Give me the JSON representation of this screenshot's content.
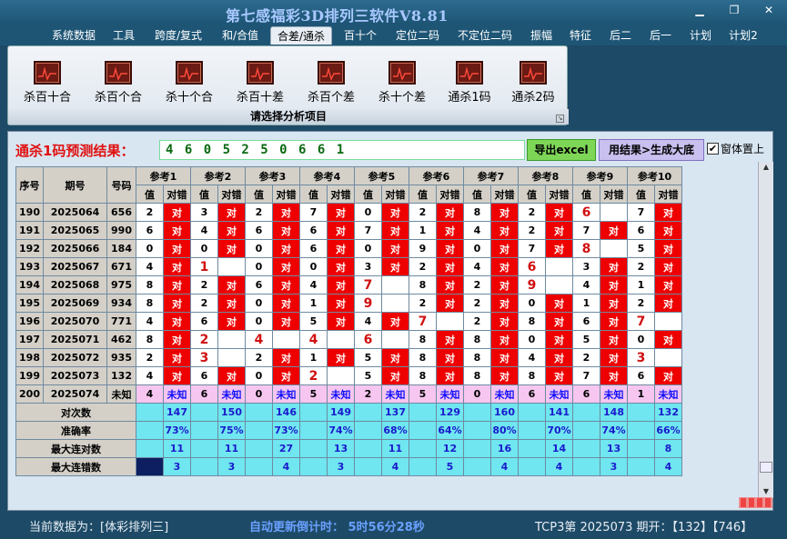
{
  "window": {
    "title": "第七感福彩3D排列三软件V8.81"
  },
  "menu": {
    "items": [
      "系统数据",
      "工具",
      "跨度/复式",
      "和/合值",
      "合差/通杀",
      "百十个",
      "定位二码",
      "不定位二码",
      "振幅",
      "特征",
      "后二",
      "后一",
      "计划",
      "计划2"
    ],
    "active": 4
  },
  "ribbon": {
    "buttons": [
      "杀百十合",
      "杀百个合",
      "杀十个合",
      "杀百十差",
      "杀百个差",
      "杀十个差",
      "通杀1码",
      "通杀2码"
    ],
    "caption": "请选择分析项目"
  },
  "prediction": {
    "label": "通杀1码预测结果：",
    "value": "4 6 0 5 2 5 0 6 6 1",
    "excel_btn": "导出excel",
    "gen_btn": "用结果>生成大底",
    "topmost_label": "窗体置上",
    "topmost_checked": true
  },
  "table": {
    "header": {
      "seq": "序号",
      "period": "期号",
      "number": "号码",
      "value_sub": "值",
      "hit_sub": "对错"
    },
    "refs": [
      "参考1",
      "参考2",
      "参考3",
      "参考4",
      "参考5",
      "参考6",
      "参考7",
      "参考8",
      "参考9",
      "参考10"
    ],
    "rows": [
      {
        "seq": "190",
        "period": "2025064",
        "num": "656",
        "vals": [
          "2",
          "3",
          "2",
          "7",
          "0",
          "2",
          "8",
          "2",
          "6",
          "7"
        ],
        "hits": [
          "对",
          "对",
          "对",
          "对",
          "对",
          "对",
          "对",
          "对",
          "",
          "对"
        ],
        "hot": [
          0,
          0,
          0,
          0,
          0,
          0,
          0,
          0,
          1,
          0
        ]
      },
      {
        "seq": "191",
        "period": "2025065",
        "num": "990",
        "vals": [
          "6",
          "4",
          "6",
          "6",
          "7",
          "1",
          "4",
          "2",
          "7",
          "6"
        ],
        "hits": [
          "对",
          "对",
          "对",
          "对",
          "对",
          "对",
          "对",
          "对",
          "对",
          "对"
        ],
        "hot": [
          0,
          0,
          0,
          0,
          0,
          0,
          0,
          0,
          0,
          0
        ]
      },
      {
        "seq": "192",
        "period": "2025066",
        "num": "184",
        "vals": [
          "0",
          "0",
          "0",
          "6",
          "0",
          "9",
          "0",
          "7",
          "8",
          "5"
        ],
        "hits": [
          "对",
          "对",
          "对",
          "对",
          "对",
          "对",
          "对",
          "对",
          "",
          "对"
        ],
        "hot": [
          0,
          0,
          0,
          0,
          0,
          0,
          0,
          0,
          1,
          0
        ]
      },
      {
        "seq": "193",
        "period": "2025067",
        "num": "671",
        "vals": [
          "4",
          "1",
          "0",
          "0",
          "3",
          "2",
          "4",
          "6",
          "3",
          "2"
        ],
        "hits": [
          "对",
          "",
          "对",
          "对",
          "对",
          "对",
          "对",
          "",
          "对",
          "对"
        ],
        "hot": [
          0,
          1,
          0,
          0,
          0,
          0,
          0,
          1,
          0,
          0
        ]
      },
      {
        "seq": "194",
        "period": "2025068",
        "num": "975",
        "vals": [
          "8",
          "2",
          "6",
          "4",
          "7",
          "8",
          "2",
          "9",
          "4",
          "1"
        ],
        "hits": [
          "对",
          "对",
          "对",
          "对",
          "",
          "对",
          "对",
          "",
          "对",
          "对"
        ],
        "hot": [
          0,
          0,
          0,
          0,
          1,
          0,
          0,
          1,
          0,
          0
        ]
      },
      {
        "seq": "195",
        "period": "2025069",
        "num": "934",
        "vals": [
          "8",
          "2",
          "0",
          "1",
          "9",
          "2",
          "2",
          "0",
          "1",
          "2"
        ],
        "hits": [
          "对",
          "对",
          "对",
          "对",
          "",
          "对",
          "对",
          "对",
          "对",
          "对"
        ],
        "hot": [
          0,
          0,
          0,
          0,
          1,
          0,
          0,
          0,
          0,
          0
        ]
      },
      {
        "seq": "196",
        "period": "2025070",
        "num": "771",
        "vals": [
          "4",
          "6",
          "0",
          "5",
          "4",
          "7",
          "2",
          "8",
          "6",
          "7"
        ],
        "hits": [
          "对",
          "对",
          "对",
          "对",
          "对",
          "",
          "对",
          "对",
          "对",
          ""
        ],
        "hot": [
          0,
          0,
          0,
          0,
          0,
          1,
          0,
          0,
          0,
          1
        ]
      },
      {
        "seq": "197",
        "period": "2025071",
        "num": "462",
        "vals": [
          "8",
          "2",
          "4",
          "4",
          "6",
          "8",
          "8",
          "0",
          "5",
          "0"
        ],
        "hits": [
          "对",
          "",
          "",
          "",
          "",
          "对",
          "对",
          "对",
          "对",
          "对"
        ],
        "hot": [
          0,
          1,
          1,
          1,
          1,
          0,
          0,
          0,
          0,
          0
        ]
      },
      {
        "seq": "198",
        "period": "2025072",
        "num": "935",
        "vals": [
          "2",
          "3",
          "2",
          "1",
          "5",
          "8",
          "8",
          "4",
          "2",
          "3"
        ],
        "hits": [
          "对",
          "",
          "对",
          "对",
          "对",
          "对",
          "对",
          "对",
          "对",
          ""
        ],
        "hot": [
          0,
          1,
          0,
          0,
          0,
          0,
          0,
          0,
          0,
          1
        ]
      },
      {
        "seq": "199",
        "period": "2025073",
        "num": "132",
        "vals": [
          "4",
          "6",
          "0",
          "2",
          "5",
          "8",
          "8",
          "8",
          "7",
          "6"
        ],
        "hits": [
          "对",
          "对",
          "对",
          "",
          "对",
          "对",
          "对",
          "对",
          "对",
          "对"
        ],
        "hot": [
          0,
          0,
          0,
          1,
          0,
          0,
          0,
          0,
          0,
          0
        ]
      },
      {
        "seq": "200",
        "period": "2025074",
        "num": "未知",
        "vals": [
          "4",
          "6",
          "0",
          "5",
          "2",
          "5",
          "0",
          "6",
          "6",
          "1"
        ],
        "hits": [
          "未知",
          "未知",
          "未知",
          "未知",
          "未知",
          "未知",
          "未知",
          "未知",
          "未知",
          "未知"
        ],
        "hot": [
          0,
          0,
          0,
          0,
          0,
          0,
          0,
          0,
          0,
          0
        ]
      }
    ],
    "stats": [
      {
        "label": "对次数",
        "values": [
          "147",
          "150",
          "146",
          "149",
          "137",
          "129",
          "160",
          "141",
          "148",
          "132"
        ]
      },
      {
        "label": "准确率",
        "values": [
          "73%",
          "75%",
          "73%",
          "74%",
          "68%",
          "64%",
          "80%",
          "70%",
          "74%",
          "66%"
        ]
      },
      {
        "label": "最大连对数",
        "values": [
          "11",
          "11",
          "27",
          "13",
          "11",
          "12",
          "16",
          "14",
          "13",
          "8"
        ]
      },
      {
        "label": "最大连错数",
        "values": [
          "3",
          "3",
          "4",
          "3",
          "4",
          "5",
          "4",
          "4",
          "3",
          "4"
        ]
      }
    ]
  },
  "status": {
    "current_data": "当前数据为：[体彩排列三]",
    "countdown": "自动更新倒计时： 5时56分28秒",
    "last_draw": "TCP3第 2025073 期开：【132】【746】"
  },
  "colors": {
    "hit": "#ee0000",
    "stat_bg": "#6fe6f0",
    "stat_text": "#1a1acc",
    "pending_row": "#f6c6f0",
    "title": "#a8c8ff"
  }
}
